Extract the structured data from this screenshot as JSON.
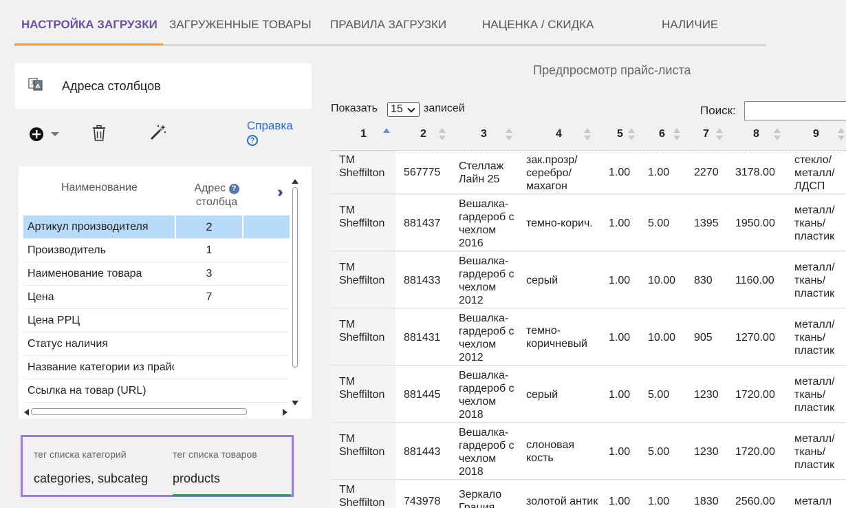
{
  "tabs": [
    {
      "label": "НАСТРОЙКА ЗАГРУЗКИ",
      "active": true
    },
    {
      "label": "ЗАГРУЖЕННЫЕ ТОВАРЫ"
    },
    {
      "label": "ПРАВИЛА ЗАГРУЗКИ"
    },
    {
      "label": "НАЦЕНКА / СКИДКА"
    },
    {
      "label": "НАЛИЧИЕ"
    }
  ],
  "columns_panel": {
    "title": "Адреса столбцов",
    "help_label": "Справка",
    "header_name": "Наименование",
    "header_address_line1": "Адрес",
    "header_address_line2": "столбца",
    "rows": [
      {
        "name": "Артикул производителя",
        "address": "2",
        "selected": true
      },
      {
        "name": "Производитель",
        "address": "1"
      },
      {
        "name": "Наименование товара",
        "address": "3"
      },
      {
        "name": "Цена",
        "address": "7"
      },
      {
        "name": "Цена РРЦ",
        "address": ""
      },
      {
        "name": "Статус наличия",
        "address": ""
      },
      {
        "name": "Название категории из прайс",
        "address": ""
      },
      {
        "name": "Ссылка на товар (URL)",
        "address": ""
      }
    ]
  },
  "tags": {
    "category_label": "тег списка категорий",
    "category_value": "categories, subcateg",
    "products_label": "тег списка товаров",
    "products_value": "products"
  },
  "preview": {
    "title": "Предпросмотр прайс-листа",
    "show_label": "Показать",
    "page_size": "15",
    "records_label": "записей",
    "search_label": "Поиск:",
    "search_value": "",
    "headers": [
      "1",
      "2",
      "3",
      "4",
      "5",
      "6",
      "7",
      "8",
      "9"
    ],
    "rows": [
      {
        "c1": "ТМ Sheffilton",
        "c2": "567775",
        "c3": "Стеллаж Лайн 25",
        "c4": "зак.прозр/ серебро/ махагон",
        "c5": "1.00",
        "c6": "1.00",
        "c7": "2270",
        "c8": "3178.00",
        "c9": "стекло/ металл/ ЛДСП"
      },
      {
        "c1": "ТМ Sheffilton",
        "c2": "881437",
        "c3": "Вешалка-гардероб с чехлом 2016",
        "c4": "темно-корич.",
        "c5": "1.00",
        "c6": "5.00",
        "c7": "1395",
        "c8": "1950.00",
        "c9": "металл/ ткань/ пластик"
      },
      {
        "c1": "ТМ Sheffilton",
        "c2": "881433",
        "c3": "Вешалка-гардероб с чехлом 2012",
        "c4": "серый",
        "c5": "1.00",
        "c6": "10.00",
        "c7": "830",
        "c8": "1160.00",
        "c9": "металл/ ткань/ пластик"
      },
      {
        "c1": "ТМ Sheffilton",
        "c2": "881431",
        "c3": "Вешалка-гардероб с чехлом 2012",
        "c4": "темно-коричневый",
        "c5": "1.00",
        "c6": "10.00",
        "c7": "905",
        "c8": "1270.00",
        "c9": "металл/ ткань/ пластик"
      },
      {
        "c1": "ТМ Sheffilton",
        "c2": "881445",
        "c3": "Вешалка-гардероб с чехлом 2018",
        "c4": "серый",
        "c5": "1.00",
        "c6": "5.00",
        "c7": "1230",
        "c8": "1720.00",
        "c9": "металл/ ткань/ пластик"
      },
      {
        "c1": "ТМ Sheffilton",
        "c2": "881443",
        "c3": "Вешалка-гардероб с чехлом 2018",
        "c4": "слоновая кость",
        "c5": "1.00",
        "c6": "5.00",
        "c7": "1230",
        "c8": "1720.00",
        "c9": "металл/ ткань/ пластик"
      },
      {
        "c1": "ТМ Sheffilton",
        "c2": "743978",
        "c3": "Зеркало Грация",
        "c4": "золотой антик",
        "c5": "1.00",
        "c6": "1.00",
        "c7": "1830",
        "c8": "2560.00",
        "c9": "металл"
      }
    ]
  },
  "colors": {
    "accent": "#6b4fa5",
    "tab_underline": "#f0a24a",
    "selected_row": "#b9dbfb",
    "tag_border": "#9c7be0",
    "link": "#2a6fc9"
  }
}
